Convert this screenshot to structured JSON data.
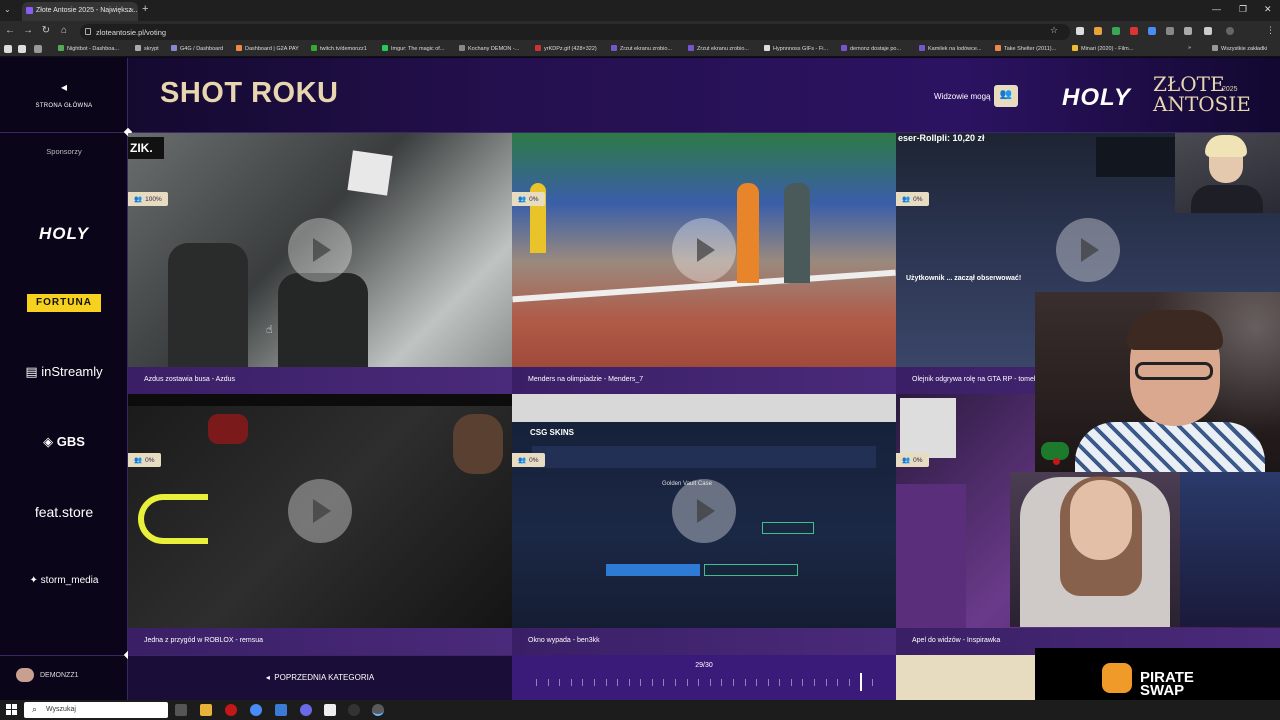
{
  "browser": {
    "tab_title": "Złote Antosie 2025 - Największ...",
    "url": "zloteantosie.pl/voting",
    "bookmarks": [
      "Nightbot - Dashboa...",
      "skrypt",
      "G4G / Dashboard",
      "Dashboard | G2A PAY",
      "twitch.tv/demonzz1",
      "Imgur: The magic of...",
      "Kochany DEMON -...",
      "yrKDPz.gif (428×322)",
      "Zrzut ekranu zrobio...",
      "Zrzut ekranu zrobio...",
      "Hypnnnoss GIFs - Fi...",
      "demonz dostaje po...",
      "Kamilek na lodówce...",
      "Take Shelter (2011)...",
      "Minari (2020) - Film...",
      "Wszystkie zakładki"
    ]
  },
  "sidebar": {
    "home_label": "STRONA GŁÓWNA",
    "sponsors_title": "Sponsorzy",
    "sponsors": [
      "HOLY",
      "FORTUNA",
      "inStreamly",
      "GBS",
      "feat.store",
      "storm_media"
    ],
    "user_name": "DEMONZZ1"
  },
  "header": {
    "title": "SHOT ROKU",
    "viewers_label": "Widzowie mogą",
    "brand_holy": "HOLY",
    "brand_zlote": "ZŁOTE",
    "brand_antosie": "ANTOSIE",
    "brand_year": "2025"
  },
  "videos": [
    {
      "caption": "Azdus zostawia busa - Azdus",
      "percent": "100%"
    },
    {
      "caption": "Menders na olimpiadzie - Menders_7",
      "percent": "0%"
    },
    {
      "caption": "Olejnik odgrywa rolę na GTA RP - tomeko",
      "percent": "0%"
    },
    {
      "caption": "Jedna z przygód w ROBLOX - remsua",
      "percent": "0%"
    },
    {
      "caption": "Okno wypada - ben3kk",
      "percent": "0%"
    },
    {
      "caption": "Apel do widzów - Inspirawka",
      "percent": "0%"
    }
  ],
  "overlay_texts": {
    "stream_tag": "ZIK.",
    "gta_chat": "Użytkownik ... zaczął obserwować!",
    "teaser": "eser-Rollpli: 10,20 zł",
    "csg_logo": "CSG SKINS",
    "case_title": "Golden Vault Case"
  },
  "pagination": {
    "prev_label": "POPRZEDNIA KATEGORIA",
    "count": "29/30",
    "current": 29,
    "total": 30
  },
  "pirate_swap": {
    "line1": "PIRATE",
    "line2": "SWAP"
  },
  "taskbar": {
    "search_placeholder": "Wyszukaj"
  },
  "colors": {
    "accent_gold": "#e7d6b0",
    "bg_purple": "#2c1362",
    "badge": "#e8dcc0"
  }
}
